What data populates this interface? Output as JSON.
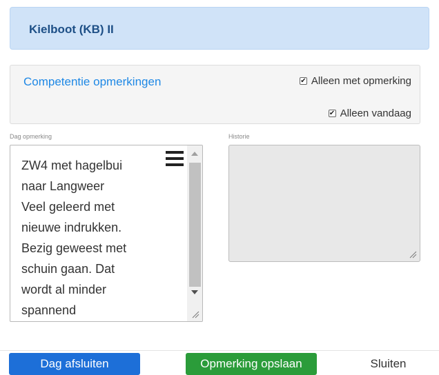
{
  "header": {
    "title": "Kielboot (KB) II"
  },
  "competentie": {
    "title": "Competentie opmerkingen",
    "checkbox_opmerking": {
      "label": "Alleen met opmerking",
      "checked": true
    },
    "checkbox_vandaag": {
      "label": "Alleen vandaag",
      "checked": true
    }
  },
  "dag_opmerking": {
    "label": "Dag opmerking",
    "lines": [
      "ZW4 met hagelbui",
      "naar Langweer",
      "Veel geleerd met",
      "nieuwe indrukken.",
      "Bezig geweest met",
      "schuin gaan. Dat",
      "wordt al minder",
      "spannend"
    ]
  },
  "historie": {
    "label": "Historie",
    "value": ""
  },
  "footer": {
    "dag_afsluiten_label": "Dag afsluiten",
    "opmerking_opslaan_label": "Opmerking opslaan",
    "sluiten_label": "Sluiten"
  },
  "colors": {
    "header_bg": "#d0e3f8",
    "title_blue": "#1d4f86",
    "link_blue": "#1e88e5",
    "primary_button": "#1d6fd8",
    "success_button": "#2b9c3a"
  },
  "icons": [
    "menu-icon",
    "checkbox-checked-icon",
    "resize-handle-icon",
    "scroll-up-icon",
    "scroll-down-icon"
  ]
}
